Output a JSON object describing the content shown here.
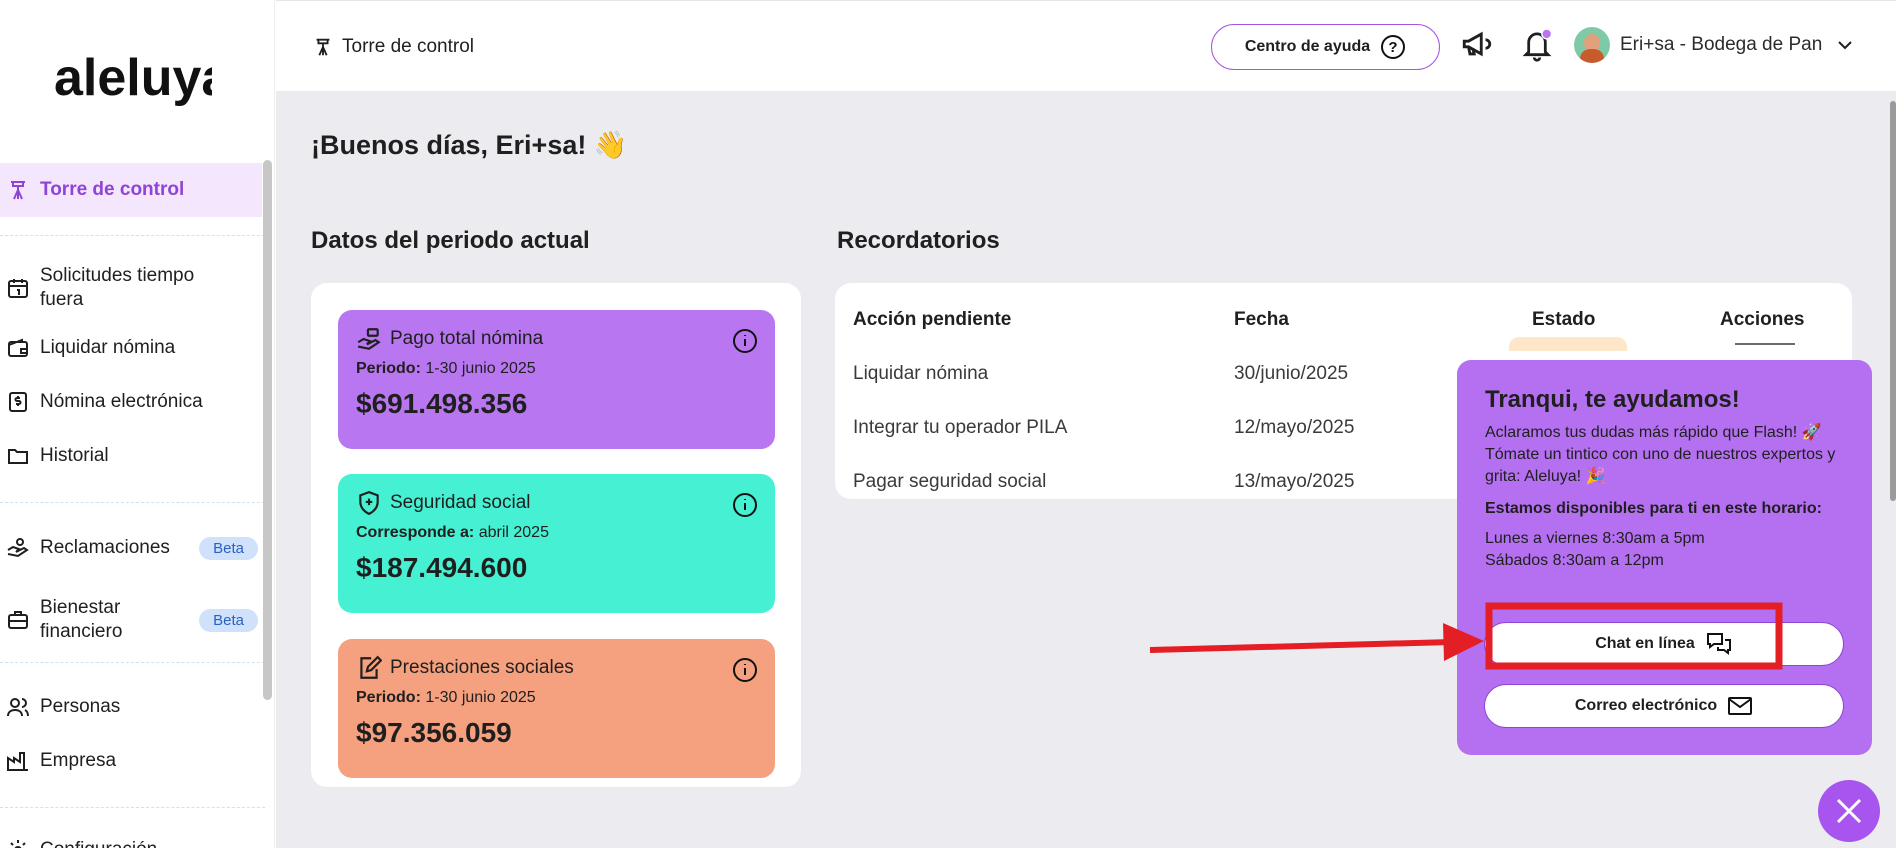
{
  "app": {
    "logo_text": "aleluya"
  },
  "sidebar": {
    "items": [
      {
        "label": "Torre de control",
        "icon": "tower-icon",
        "active": true
      },
      {
        "label": "Solicitudes tiempo fuera",
        "icon": "calendar-icon"
      },
      {
        "label": "Liquidar nómina",
        "icon": "wallet-icon"
      },
      {
        "label": "Nómina electrónica",
        "icon": "dollar-doc-icon"
      },
      {
        "label": "Historial",
        "icon": "folder-icon"
      },
      {
        "label": "Reclamaciones",
        "icon": "hand-icon",
        "badge": "Beta"
      },
      {
        "label": "Bienestar financiero",
        "icon": "briefcase-icon",
        "badge": "Beta"
      },
      {
        "label": "Personas",
        "icon": "people-icon"
      },
      {
        "label": "Empresa",
        "icon": "factory-icon"
      },
      {
        "label": "Configuración",
        "icon": "gear-icon"
      }
    ]
  },
  "header": {
    "breadcrumb": "Torre de control",
    "help_button": "Centro de ayuda",
    "user_name": "Eri+sa - Bodega de Pan"
  },
  "main": {
    "greeting": "¡Buenos días, Eri+sa! 👋",
    "period_title": "Datos del periodo actual",
    "reminders_title": "Recordatorios",
    "kpis": [
      {
        "title": "Pago total nómina",
        "sub_label": "Periodo:",
        "sub_value": "1-30 junio 2025",
        "value": "$691.498.356",
        "color": "#b877f0",
        "icon": "hand-money-icon"
      },
      {
        "title": "Seguridad social",
        "sub_label": "Corresponde a:",
        "sub_value": "abril 2025",
        "value": "$187.494.600",
        "color": "#46f0d2",
        "icon": "shield-plus-icon"
      },
      {
        "title": "Prestaciones sociales",
        "sub_label": "Periodo:",
        "sub_value": "1-30 junio 2025",
        "value": "$97.356.059",
        "color": "#f5a07e",
        "icon": "edit-doc-icon"
      }
    ],
    "reminders": {
      "columns": [
        "Acción pendiente",
        "Fecha",
        "Estado",
        "Acciones"
      ],
      "rows": [
        {
          "action": "Liquidar nómina",
          "date": "30/junio/2025"
        },
        {
          "action": "Integrar tu operador PILA",
          "date": "12/mayo/2025"
        },
        {
          "action": "Pagar seguridad social",
          "date": "13/mayo/2025"
        }
      ]
    }
  },
  "popup": {
    "title": "Tranqui, te ayudamos!",
    "line1": "Aclaramos tus dudas más rápido que Flash! 🚀",
    "line2": "Tómate un tintico con uno de nuestros expertos y grita: Aleluya! 🎉",
    "schedule_title": "Estamos disponibles para ti en este horario:",
    "schedule_1": "Lunes a viernes 8:30am a 5pm",
    "schedule_2": "Sábados 8:30am a 12pm",
    "chat_button": "Chat en línea",
    "email_button": "Correo electrónico"
  },
  "colors": {
    "accent": "#a855f0",
    "annotation": "#e31e24"
  }
}
